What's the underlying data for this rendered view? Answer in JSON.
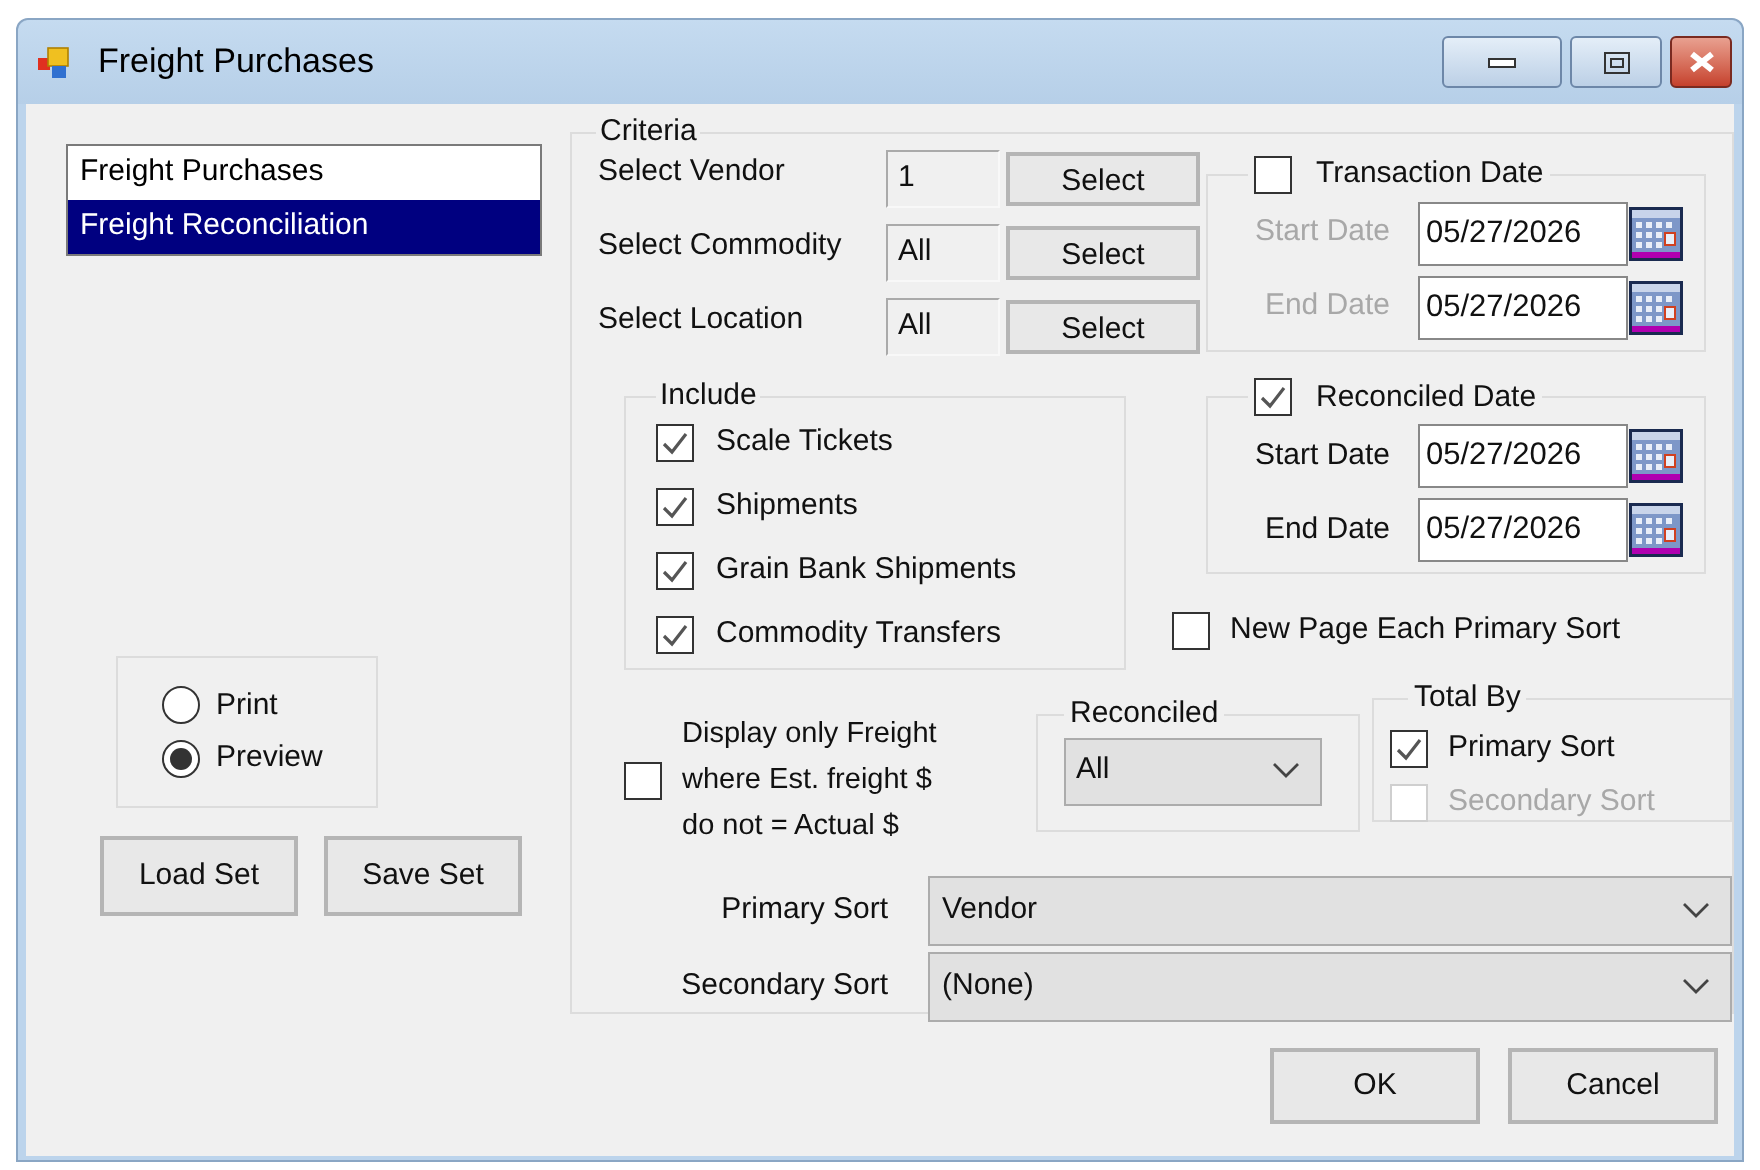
{
  "window": {
    "title": "Freight Purchases"
  },
  "report_list": [
    {
      "label": "Freight Purchases",
      "selected": false
    },
    {
      "label": "Freight Reconciliation",
      "selected": true
    }
  ],
  "output": [
    {
      "label": "Print",
      "selected": false
    },
    {
      "label": "Preview",
      "selected": true
    }
  ],
  "set_buttons": [
    "Load Set",
    "Save Set"
  ],
  "criteria": {
    "title": "Criteria",
    "selectors": [
      {
        "label": "Select Vendor",
        "value": "1",
        "button": "Select"
      },
      {
        "label": "Select Commodity",
        "value": "All",
        "button": "Select"
      },
      {
        "label": "Select Location",
        "value": "All",
        "button": "Select"
      }
    ],
    "include": {
      "title": "Include",
      "items": [
        {
          "label": "Scale Tickets",
          "checked": true
        },
        {
          "label": "Shipments",
          "checked": true
        },
        {
          "label": "Grain Bank Shipments",
          "checked": true
        },
        {
          "label": "Commodity Transfers",
          "checked": true
        }
      ]
    },
    "date_groups": [
      {
        "label": "Transaction Date",
        "checked": false,
        "fields": [
          {
            "label": "Start Date",
            "value": "05/27/2026"
          },
          {
            "label": "End Date",
            "value": "05/27/2026"
          }
        ]
      },
      {
        "label": "Reconciled Date",
        "checked": true,
        "fields": [
          {
            "label": "Start Date",
            "value": "05/27/2026"
          },
          {
            "label": "End Date",
            "value": "05/27/2026"
          }
        ]
      }
    ],
    "new_page_each_primary_sort": {
      "label": "New Page Each Primary Sort",
      "checked": false
    },
    "freight_filter": {
      "label_lines": [
        "Display only Freight",
        "where Est. freight $",
        "do not = Actual $"
      ],
      "checked": false
    },
    "reconciled": {
      "title": "Reconciled",
      "value": "All"
    },
    "total_by": {
      "title": "Total By",
      "items": [
        {
          "label": "Primary Sort",
          "checked": true,
          "disabled": false
        },
        {
          "label": "Secondary Sort",
          "checked": false,
          "disabled": true
        }
      ]
    },
    "sorts": [
      {
        "label": "Primary Sort",
        "value": "Vendor"
      },
      {
        "label": "Secondary Sort",
        "value": "(None)"
      }
    ]
  },
  "buttons": [
    "OK",
    "Cancel"
  ]
}
